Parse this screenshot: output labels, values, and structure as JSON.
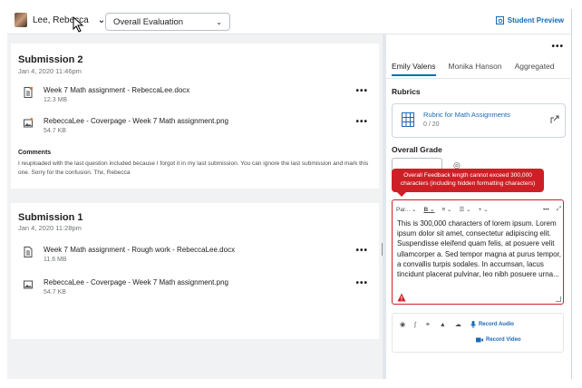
{
  "header": {
    "user_name": "Lee, Rebecca",
    "evaluation_select": "Overall Evaluation",
    "student_preview": "Student Preview"
  },
  "submissions": [
    {
      "title": "Submission 2",
      "date": "Jan 4, 2020 11:46pm",
      "files": [
        {
          "name": "Week 7 Math assignment - RebeccaLee.docx",
          "size": "12.3 MB",
          "icon": "document-icon"
        },
        {
          "name": "RebeccaLee - Coverpage - Week 7 Math assignment.png",
          "size": "54.7 KB",
          "icon": "image-icon"
        }
      ],
      "comments_label": "Comments",
      "comments": "I reuploaded with the last question included because I forgot it in my last submission. You can ignore the last submission and mark this one. Sorry for the confusion. Thx, Rebecca"
    },
    {
      "title": "Submission 1",
      "date": "Jan 4, 2020 11:28pm",
      "files": [
        {
          "name": "Week 7 Math assignment - Rough work - RebeccaLee.docx",
          "size": "11.6 MB",
          "icon": "document-icon"
        },
        {
          "name": "RebeccaLee - Coverpage - Week 7 Math assignment.png",
          "size": "54.7 KB",
          "icon": "image-icon"
        }
      ]
    }
  ],
  "panel": {
    "tabs": [
      "Emily Valens",
      "Monika Hanson",
      "Aggregated"
    ],
    "rubrics_label": "Rubrics",
    "rubric_name": "Rubric for Math Assignments",
    "rubric_score": "0 / 20",
    "overall_grade_label": "Overall Grade",
    "error_tooltip": "Overall Feedback length cannot exceed 300,000 characters (including hidden formatting characters)",
    "toolbar": {
      "paragraph": "Par...",
      "bold": "B",
      "align": "≡",
      "list": "☰",
      "insert": "+"
    },
    "feedback_text": "This is 300,000 characters of lorem ipsum. Lorem ipsum dolor sit amet, consectetur adipiscing elit. Suspendisse eleifend quam felis, at posuere velit ullamcorper a. Sed tempor magna at purus tempor, a convallis turpis sodales. In accumsan, lacus tincidunt placerat pulvinar, leo nibh posuere urna...",
    "record_audio": "Record Audio",
    "record_video": "Record Video"
  },
  "colors": {
    "accent": "#006fbf",
    "link": "#1a6ab5",
    "error": "#cd2026"
  }
}
